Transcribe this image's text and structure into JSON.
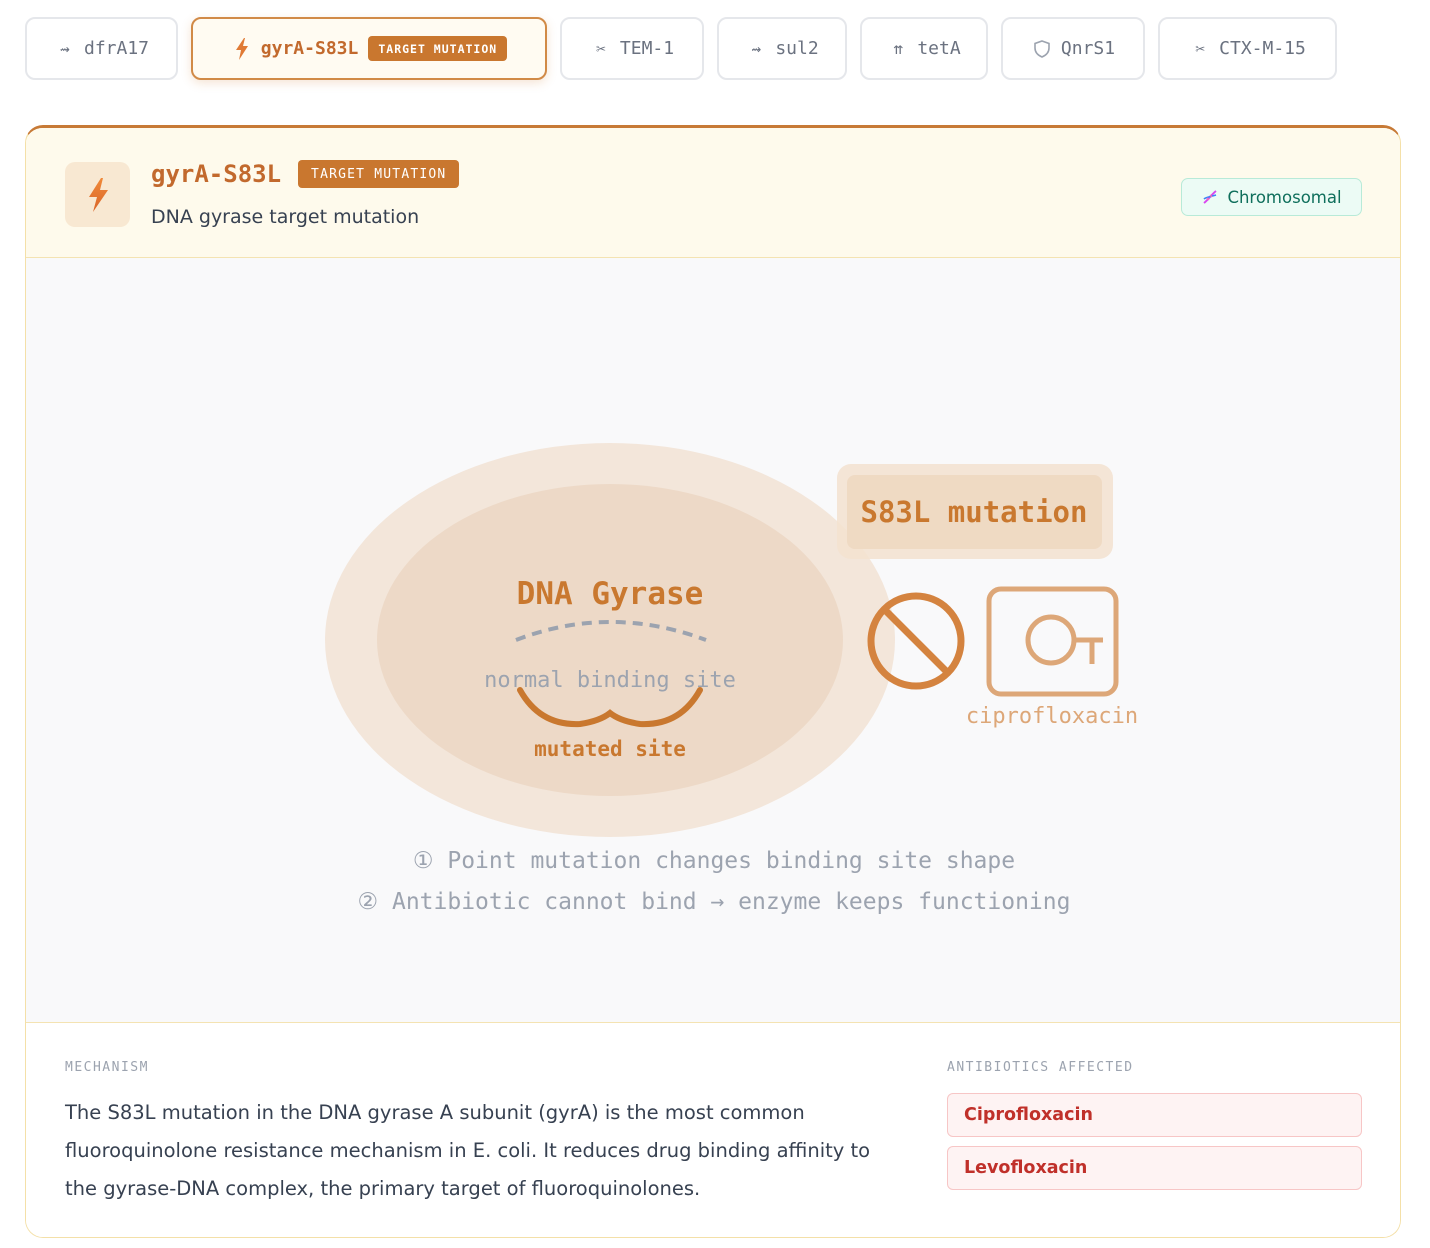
{
  "tabs": [
    {
      "label": "dfrA17",
      "icon": "arrow-right-icon"
    },
    {
      "label": "gyrA-S83L",
      "icon": "lightning-icon",
      "badge": "TARGET MUTATION",
      "active": true
    },
    {
      "label": "TEM-1",
      "icon": "scissors-icon"
    },
    {
      "label": "sul2",
      "icon": "arrow-right-icon"
    },
    {
      "label": "tetA",
      "icon": "pump-arrows-icon"
    },
    {
      "label": "QnrS1",
      "icon": "shield-icon"
    },
    {
      "label": "CTX-M-15",
      "icon": "scissors-icon"
    }
  ],
  "detail": {
    "name": "gyrA-S83L",
    "badge": "TARGET MUTATION",
    "subtitle": "DNA gyrase target mutation",
    "location": "Chromosomal",
    "location_icon": "dna-icon"
  },
  "diagram": {
    "enzyme_label": "DNA Gyrase",
    "normal_site_label": "normal binding site",
    "mutated_site_label": "mutated site",
    "mutation_label": "S83L mutation",
    "blocked_icon": "no-entry-icon",
    "drug_icon": "key-icon",
    "drug_label": "ciprofloxacin",
    "steps": [
      "① Point mutation changes binding site shape",
      "② Antibiotic cannot bind → enzyme keeps functioning"
    ]
  },
  "mechanism": {
    "label": "MECHANISM",
    "text": "The S83L mutation in the DNA gyrase A subunit (gyrA) is the most common fluoroquinolone resistance mechanism in E. coli. It reduces drug binding affinity to the gyrase-DNA complex, the primary target of fluoroquinolones."
  },
  "antibiotics": {
    "label": "ANTIBIOTICS AFFECTED",
    "items": [
      "Ciprofloxacin",
      "Levofloxacin"
    ]
  },
  "colors": {
    "accent": "#c9772f",
    "accent_light": "#f8e8d2",
    "chromosomal": "#0f6f5c",
    "antibiotic_red": "#c0302a"
  }
}
